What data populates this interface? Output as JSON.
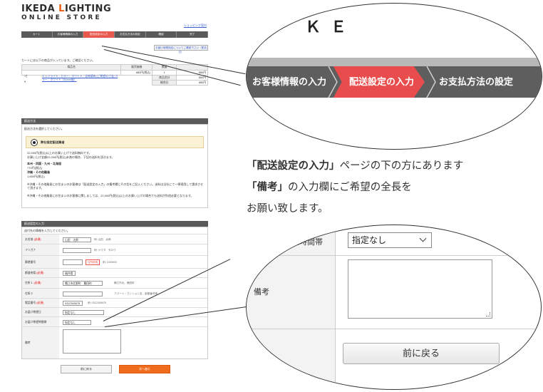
{
  "logo": {
    "line1_a": "IKEDA ",
    "line1_b": "L",
    "line1_c": "IGHTING",
    "line2": "ONLINE STORE"
  },
  "header": {
    "shopping_guide_link": "ショッピング案内"
  },
  "steps": [
    "カート",
    "お客様情報の入力",
    "配送設定の入力",
    "お支払方法の設定",
    "確認",
    "完了"
  ],
  "page": {
    "search_button": "お買い物を続ける",
    "rate_link": "お届け時間指定についてご確認下さい（配送日）",
    "cart_intro": "カートには以下の商品が入っています。ご確認ください。"
  },
  "cart": {
    "headers": [
      "商品名",
      "販売価格",
      "数量",
      ""
    ],
    "item_name": "エッジライト - カラー：ホワイト、定格値有 [ご希望の寸法] カラー：ホワイト（50mm幅）",
    "item_price": "880円(税込)",
    "item_qty": "1",
    "item_subtotal": "880円",
    "subtotal_label": "商品合計",
    "subtotal_value": "880円",
    "total_label": "総合計",
    "total_value": "880円"
  },
  "shipping": {
    "title": "配送方法",
    "intro": "配送方法を選択してください。",
    "option": "弊社指定配送業者",
    "line1": "22,000円(税込)以上のお買い上げで送料無料です。",
    "line2": "お買い上げ金額22,000円(税込)未満の場合、下記の送料を頂きます。",
    "region1": "本州・四国・九州・北海道",
    "region1_price": "770円(税込)",
    "region2": "沖縄・その他離島",
    "region2_price": "1,650円(税込)",
    "note1": "※沖縄・その他離島にお住まいのお客様は「配送設定の入力」の備考欄にその旨をご記入ください。送料は当社にて一律適用して請求させて頂きます。",
    "note2": "※沖縄・その他離島にお住まいのお客様に関しましては、22,000円(税込)以上のお買い上げの場合でも送料が別途必要となります。"
  },
  "delivery_form": {
    "title": "配送設定の入力",
    "intro": "送付先の情報を入力してください。",
    "required": "(必須)",
    "fields": [
      {
        "label": "お名前",
        "required": true,
        "value": "山田　太郎",
        "hint": "例: 山田　太郎"
      },
      {
        "label": "フリガナ",
        "required": false,
        "value": "",
        "hint": "例: ヤマダ　タロウ"
      },
      {
        "label": "郵便番号",
        "required": false,
        "value": "",
        "hint": "例: 1000000"
      },
      {
        "label": "都道府県",
        "required": true,
        "value": "福井県",
        "hint": ""
      },
      {
        "label": "住所１",
        "required": true,
        "value": "鯖江市北野町　鯖田町",
        "hint": "鯖江市北、鯖田町"
      },
      {
        "label": "住所２",
        "required": false,
        "value": "",
        "hint": "アパート・マンション名、部屋番号等"
      },
      {
        "label": "電話番号",
        "required": true,
        "value": "0312345678",
        "hint": "例: 0312345678"
      },
      {
        "label": "お届け希望日",
        "required": false,
        "value": "指定なし",
        "hint": ""
      },
      {
        "label": "お届け希望時間帯",
        "required": false,
        "value": "指定なし",
        "hint": ""
      },
      {
        "label": "備考",
        "required": false,
        "value": "",
        "hint": ""
      }
    ],
    "zip_button": "住所検索",
    "back_button": "前に戻る",
    "next_button": "次へ進む"
  },
  "zoom_top": {
    "bg_text": "ＫＥ",
    "steps": [
      "お客様情報の入力",
      "配送設定の入力",
      "お支払方法の設定"
    ]
  },
  "caption": {
    "line1_bold": "「配送設定の入力」",
    "line1_rest": "ページの下の方にあります",
    "line2_bold": "「備考」",
    "line2_rest": "の入力欄にご希望の全長を",
    "line3": "お願い致します。"
  },
  "zoom_bottom": {
    "time_label": "希望時間帯",
    "select_value": "指定なし",
    "notes_label": "備考",
    "back_button": "前に戻る"
  },
  "colors": {
    "accent_orange": "#f06b1b",
    "step_active": "#e94c4c",
    "step_bar": "#5e5e5e",
    "required_red": "#e60000"
  }
}
